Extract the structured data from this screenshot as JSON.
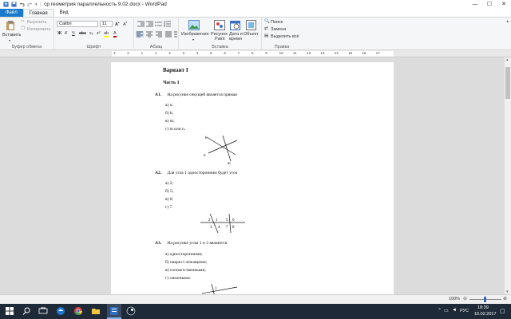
{
  "window": {
    "title": "ср геометрия параллельность 9.02.docx - WordPad",
    "minimize": "—",
    "maximize": "☐",
    "close": "✕"
  },
  "tabs": [
    {
      "label": "Файл"
    },
    {
      "label": "Главная"
    },
    {
      "label": "Вид"
    }
  ],
  "ribbon": {
    "clipboard": {
      "paste": "Вставить",
      "cut": "Вырезать",
      "copy": "Копировать",
      "group": "Буфер обмена"
    },
    "font": {
      "family": "Calibri",
      "size": "11",
      "group": "Шрифт"
    },
    "paragraph": {
      "group": "Абзац"
    },
    "insert": {
      "image": "Изображение",
      "paint1": "Рисунок",
      "paint2": "Paint",
      "datetime1": "Дата и",
      "datetime2": "время",
      "object": "Объект",
      "group": "Вставка"
    },
    "edit": {
      "find": "Поиск",
      "replace": "Замена",
      "selectall": "Выделить всё",
      "group": "Правка"
    }
  },
  "ruler": {
    "ticks": [
      "3",
      "2",
      "1",
      "1",
      "2",
      "3",
      "4",
      "5",
      "6",
      "7",
      "8",
      "9",
      "10",
      "11",
      "12",
      "13",
      "14",
      "15",
      "16",
      "17"
    ]
  },
  "document": {
    "variant": "Вариант I",
    "part": "Часть 1",
    "questions": [
      {
        "num": "А1.",
        "text": "На рисунке секущей является прямая",
        "options": [
          "а)  n;",
          "б)  k;",
          "в)  m;",
          "г)  m или n."
        ]
      },
      {
        "num": "А2.",
        "text": "Для угла 1 односторонним будет угол",
        "options": [
          "а)  2;",
          "б)  5;",
          "в)  6;",
          "г)  7."
        ]
      },
      {
        "num": "А3.",
        "text": "На рисунке углы 1 и 2 являются",
        "options": [
          "а)  односторонними;",
          "б)  накрест лежащими;",
          "в)  соответственными;",
          "г)  смежными."
        ]
      }
    ],
    "fig1_labels": [
      "k",
      "n",
      "m"
    ],
    "fig2_labels": [
      "2",
      "1",
      "5",
      "6",
      "3",
      "4",
      "7",
      "8"
    ],
    "fig3_labels": [
      "1"
    ]
  },
  "status": {
    "zoom": "100%"
  },
  "taskbar": {
    "lang": "РУС",
    "time": "18:39",
    "date": "10.02.2017"
  },
  "colors": {
    "file_tab": "#1979ca",
    "taskbar": "#1f2a38"
  }
}
